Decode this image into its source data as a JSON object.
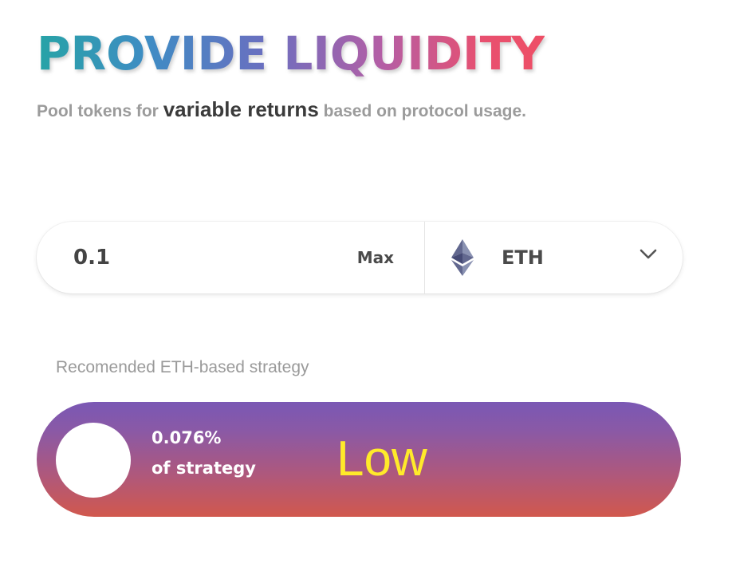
{
  "header": {
    "title": "PROVIDE LIQUIDITY",
    "subtitle_prefix": "Pool tokens for ",
    "subtitle_strong": "variable returns",
    "subtitle_suffix": " based on protocol usage."
  },
  "amount": {
    "value": "0.1",
    "max_label": "Max"
  },
  "token": {
    "symbol": "ETH",
    "icon": "ethereum-icon",
    "dropdown_icon": "chevron-down-icon"
  },
  "recommendation": {
    "label": "Recomended ETH-based strategy"
  },
  "strategy": {
    "percent": "0.076%",
    "of_label": "of strategy",
    "level": "Low",
    "level_color": "#ffea2a"
  },
  "colors": {
    "title_gradient": [
      "#27a3a6",
      "#6a6fc0",
      "#ee4f66"
    ],
    "strategy_gradient": [
      "#7a58b4",
      "#d1584d"
    ]
  }
}
